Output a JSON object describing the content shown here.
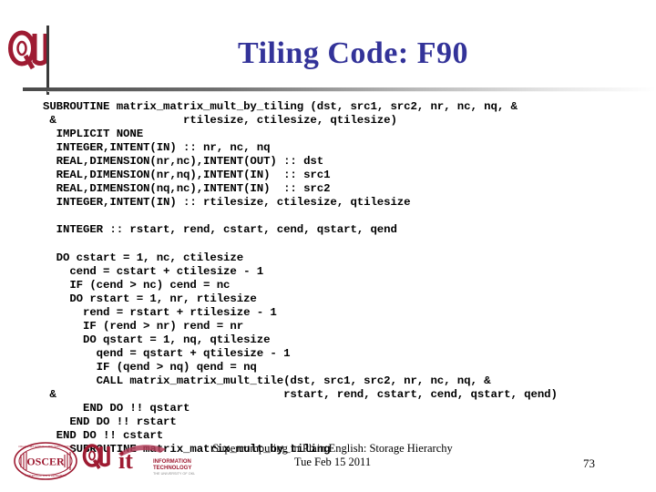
{
  "header": {
    "title": "Tiling Code: F90",
    "title_color": "#333399",
    "ou_logo_icon": "ou-logo-icon",
    "rule_color": "#4a4a4a"
  },
  "code": {
    "language": "Fortran 90",
    "lines": [
      "SUBROUTINE matrix_matrix_mult_by_tiling (dst, src1, src2, nr, nc, nq, &",
      " &                   rtilesize, ctilesize, qtilesize)",
      "  IMPLICIT NONE",
      "  INTEGER,INTENT(IN) :: nr, nc, nq",
      "  REAL,DIMENSION(nr,nc),INTENT(OUT) :: dst",
      "  REAL,DIMENSION(nr,nq),INTENT(IN)  :: src1",
      "  REAL,DIMENSION(nq,nc),INTENT(IN)  :: src2",
      "  INTEGER,INTENT(IN) :: rtilesize, ctilesize, qtilesize",
      "",
      "  INTEGER :: rstart, rend, cstart, cend, qstart, qend",
      "",
      "  DO cstart = 1, nc, ctilesize",
      "    cend = cstart + ctilesize - 1",
      "    IF (cend > nc) cend = nc",
      "    DO rstart = 1, nr, rtilesize",
      "      rend = rstart + rtilesize - 1",
      "      IF (rend > nr) rend = nr",
      "      DO qstart = 1, nq, qtilesize",
      "        qend = qstart + qtilesize - 1",
      "        IF (qend > nq) qend = nq",
      "        CALL matrix_matrix_mult_tile(dst, src1, src2, nr, nc, nq, &",
      " &                                  rstart, rend, cstart, cend, qstart, qend)",
      "      END DO !! qstart",
      "    END DO !! rstart",
      "  END DO !! cstart",
      "END SUBROUTINE matrix_matrix_mult_by_tiling"
    ]
  },
  "footer": {
    "line1": "Supercomputing in Plain English: Storage Hierarchy",
    "line2": "Tue Feb 15 2011",
    "page_number": "73",
    "logos": [
      {
        "name": "oscer-logo-icon",
        "label": "OSCER"
      },
      {
        "name": "ou-logo-icon",
        "label": "OU"
      },
      {
        "name": "it-logo-icon",
        "label": "INFORMATION TECHNOLOGY"
      }
    ]
  },
  "colors": {
    "crimson": "#9e1b32",
    "title_blue": "#333399",
    "rule_dark": "#3a3a3a"
  }
}
